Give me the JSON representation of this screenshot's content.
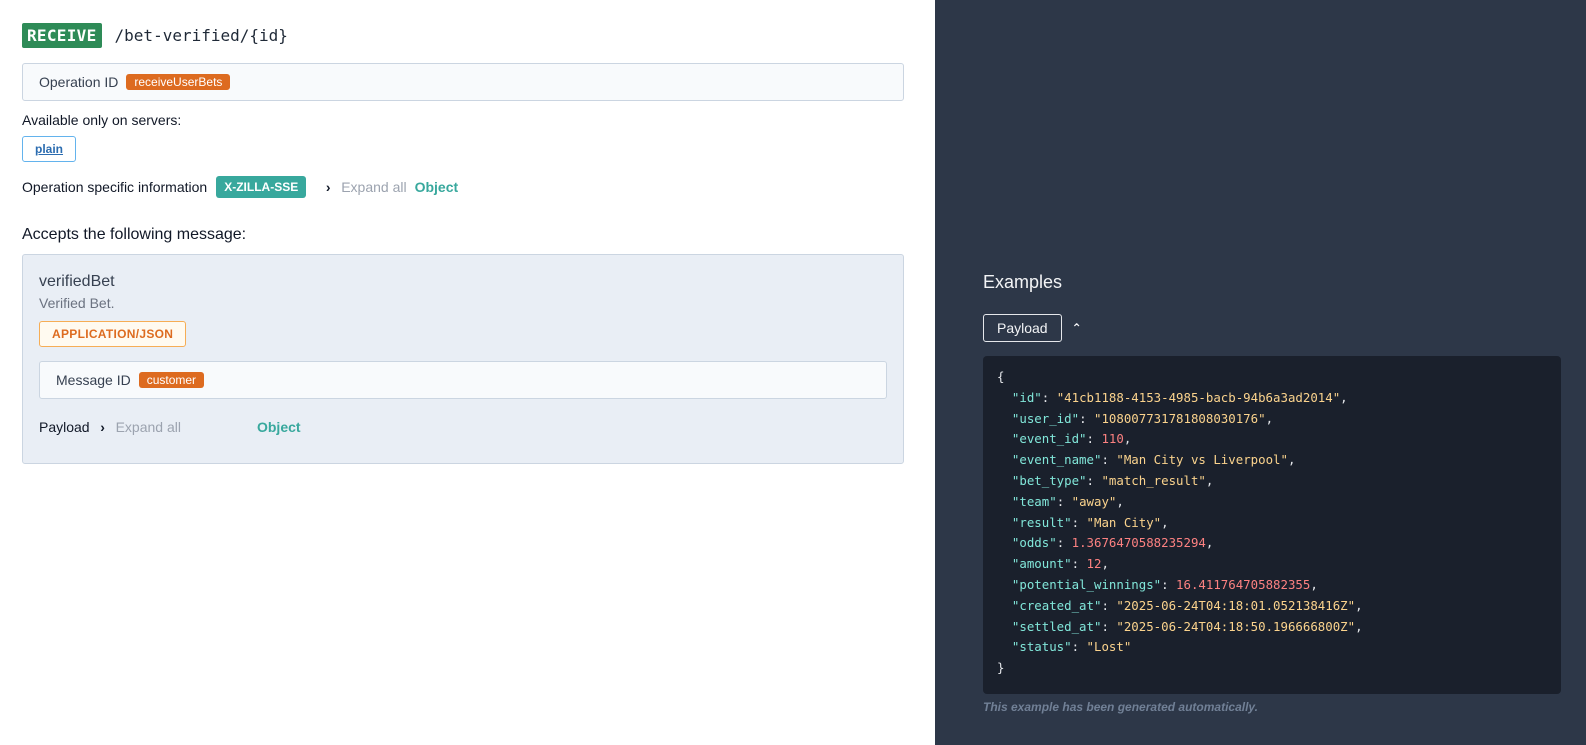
{
  "operation": {
    "action": "RECEIVE",
    "path": "/bet-verified/{id}",
    "id_label": "Operation ID",
    "id_value": "receiveUserBets",
    "servers_label": "Available only on servers:",
    "server": "plain",
    "info_label": "Operation specific information",
    "binding": "X-ZILLA-SSE",
    "expand_all": "Expand all",
    "object_label": "Object"
  },
  "message": {
    "accepts_label": "Accepts the following message:",
    "name": "verifiedBet",
    "description": "Verified Bet.",
    "content_type": "APPLICATION/JSON",
    "id_label": "Message ID",
    "id_value": "customer",
    "payload_label": "Payload",
    "expand_all": "Expand all",
    "object_label": "Object"
  },
  "examples": {
    "title": "Examples",
    "payload_button": "Payload",
    "note": "This example has been generated automatically.",
    "fields": [
      {
        "key": "id",
        "value": "41cb1188-4153-4985-bacb-94b6a3ad2014",
        "type": "string"
      },
      {
        "key": "user_id",
        "value": "108007731781808030176",
        "type": "string"
      },
      {
        "key": "event_id",
        "value": "110",
        "type": "number"
      },
      {
        "key": "event_name",
        "value": "Man City vs Liverpool",
        "type": "string"
      },
      {
        "key": "bet_type",
        "value": "match_result",
        "type": "string"
      },
      {
        "key": "team",
        "value": "away",
        "type": "string"
      },
      {
        "key": "result",
        "value": "Man City",
        "type": "string"
      },
      {
        "key": "odds",
        "value": "1.3676470588235294",
        "type": "number"
      },
      {
        "key": "amount",
        "value": "12",
        "type": "number"
      },
      {
        "key": "potential_winnings",
        "value": "16.411764705882355",
        "type": "number"
      },
      {
        "key": "created_at",
        "value": "2025-06-24T04:18:01.052138416Z",
        "type": "string"
      },
      {
        "key": "settled_at",
        "value": "2025-06-24T04:18:50.196666800Z",
        "type": "string"
      },
      {
        "key": "status",
        "value": "Lost",
        "type": "string"
      }
    ]
  },
  "colors": {
    "receive_badge": "#2e8b57",
    "tag_orange": "#dd6b20",
    "tag_teal": "#38a89d",
    "sidebar_bg": "#2d3748",
    "code_bg": "#1a202c"
  }
}
